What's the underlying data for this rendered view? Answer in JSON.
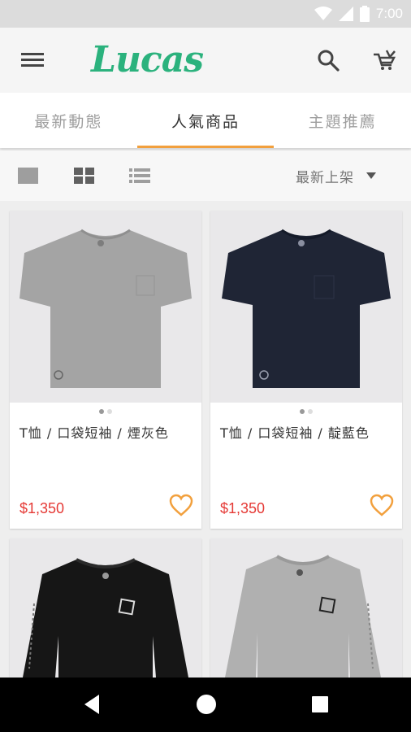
{
  "status_bar": {
    "time": "7:00"
  },
  "app": {
    "logo": "Lucas",
    "brand_color": "#2bb27d",
    "accent_color": "#f2a03d"
  },
  "tabs": [
    {
      "label": "最新動態",
      "active": false
    },
    {
      "label": "人氣商品",
      "active": true
    },
    {
      "label": "主題推薦",
      "active": false
    }
  ],
  "view_bar": {
    "sort_label": "最新上架",
    "views": [
      "single-view-icon",
      "grid-view-icon",
      "list-view-icon"
    ]
  },
  "products": [
    {
      "name": "T恤 / 口袋短袖 / 煙灰色",
      "price": "$1,350",
      "color": "heather-gray",
      "image_pages": 2,
      "current_page": 1
    },
    {
      "name": "T恤 / 口袋短袖 / 靛藍色",
      "price": "$1,350",
      "color": "navy",
      "image_pages": 2,
      "current_page": 1
    },
    {
      "name": "",
      "price": "",
      "color": "black"
    },
    {
      "name": "",
      "price": "",
      "color": "gray"
    }
  ],
  "price_color": "#e53935"
}
